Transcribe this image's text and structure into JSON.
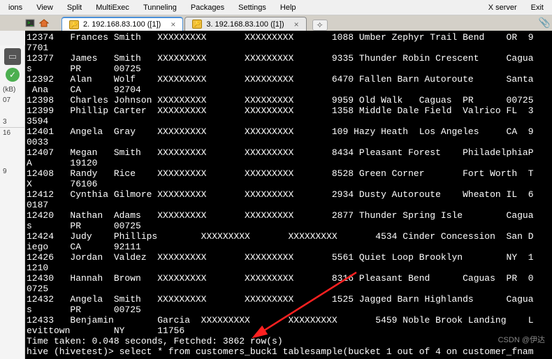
{
  "menu": {
    "left": [
      "ions",
      "View",
      "Split",
      "MultiExec",
      "Tunneling",
      "Packages",
      "Settings",
      "Help"
    ],
    "right": [
      "X server",
      "Exit"
    ]
  },
  "tabs": [
    {
      "label": "2. 192.168.83.100 ([1])",
      "active": true
    },
    {
      "label": "3. 192.168.83.100 ([1])",
      "active": false
    }
  ],
  "sidebar": {
    "kb": "(kB)",
    "n1": "07",
    "n2": "3",
    "n3": "16",
    "n4": "9"
  },
  "terminal_lines": [
    "12374   Frances Smith   XXXXXXXXX       XXXXXXXXX       1088 Umber Zephyr Trail Bend    OR  9",
    "7701",
    "12377   James   Smith   XXXXXXXXX       XXXXXXXXX       9335 Thunder Robin Crescent     Cagua",
    "s       PR      00725",
    "12392   Alan    Wolf    XXXXXXXXX       XXXXXXXXX       6470 Fallen Barn Autoroute      Santa",
    " Ana    CA      92704",
    "12398   Charles Johnson XXXXXXXXX       XXXXXXXXX       9959 Old Walk   Caguas  PR      00725",
    "12399   Phillip Carter  XXXXXXXXX       XXXXXXXXX       1358 Middle Dale Field  Valrico FL  3",
    "3594",
    "12401   Angela  Gray    XXXXXXXXX       XXXXXXXXX       109 Hazy Heath  Los Angeles     CA  9",
    "0033",
    "12407   Megan   Smith   XXXXXXXXX       XXXXXXXXX       8434 Pleasant Forest    PhiladelphiaP",
    "A       19120",
    "12408   Randy   Rice    XXXXXXXXX       XXXXXXXXX       8528 Green Corner       Fort Worth  T",
    "X       76106",
    "12412   Cynthia Gilmore XXXXXXXXX       XXXXXXXXX       2934 Dusty Autoroute    Wheaton IL  6",
    "0187",
    "12420   Nathan  Adams   XXXXXXXXX       XXXXXXXXX       2877 Thunder Spring Isle        Cagua",
    "s       PR      00725",
    "12424   Judy    Phillips        XXXXXXXXX       XXXXXXXXX       4534 Cinder Concession  San D",
    "iego    CA      92111",
    "12426   Jordan  Valdez  XXXXXXXXX       XXXXXXXXX       5561 Quiet Loop Brooklyn        NY  1",
    "1210",
    "12430   Hannah  Brown   XXXXXXXXX       XXXXXXXXX       8316 Pleasant Bend      Caguas  PR  0",
    "0725",
    "12432   Angela  Smith   XXXXXXXXX       XXXXXXXXX       1525 Jagged Barn Highlands      Cagua",
    "s       PR      00725",
    "12433   Benjamin        Garcia  XXXXXXXXX       XXXXXXXXX       5459 Noble Brook Landing    L",
    "evittown        NY      11756",
    "Time taken: 0.048 seconds, Fetched: 3862 row(s)",
    "hive (hivetest)> select * from customers_buck1 tablesample(bucket 1 out of 4 on customer_fnam"
  ],
  "watermark": "CSDN @伊达"
}
